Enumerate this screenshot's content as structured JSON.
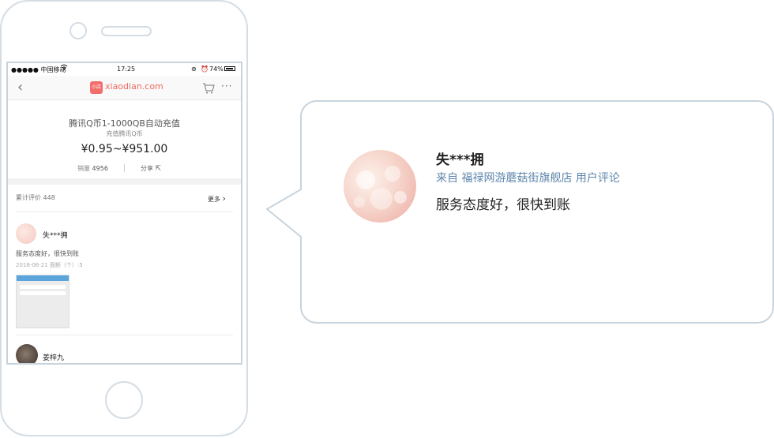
{
  "status_bar": {
    "carrier": "●●●●● 中国移动",
    "wifi_icon": "wifi-icon",
    "time": "17:25",
    "battery": "74%"
  },
  "nav": {
    "back_icon": "chevron-left-icon",
    "logo_badge": "小店",
    "logo_text": "xiaodian.com",
    "cart_icon": "cart-icon",
    "more_icon": "more-icon"
  },
  "product": {
    "title": "腾讯Q币1-1000QB自动充值",
    "subtitle": "充值腾讯Q币",
    "price": "¥0.95~¥951.00",
    "sales_label": "销量",
    "sales_count": "4956",
    "share_label": "分享"
  },
  "reviews": {
    "header_label": "累计评价",
    "count": "448",
    "more_label": "更多",
    "items": [
      {
        "name": "失***拥",
        "text": "服务态度好，很快到账",
        "date": "2016-06-21",
        "spec": "面额（个）:5"
      },
      {
        "name": "姜梓九"
      }
    ]
  },
  "bubble": {
    "name": "失***拥",
    "source": "来自 福禄网游蘑菇街旗舰店 用户评论",
    "text": "服务态度好，很快到账"
  },
  "colors": {
    "frame": "#d4dde4",
    "accent": "#f06a60",
    "link": "#5f87ad"
  }
}
